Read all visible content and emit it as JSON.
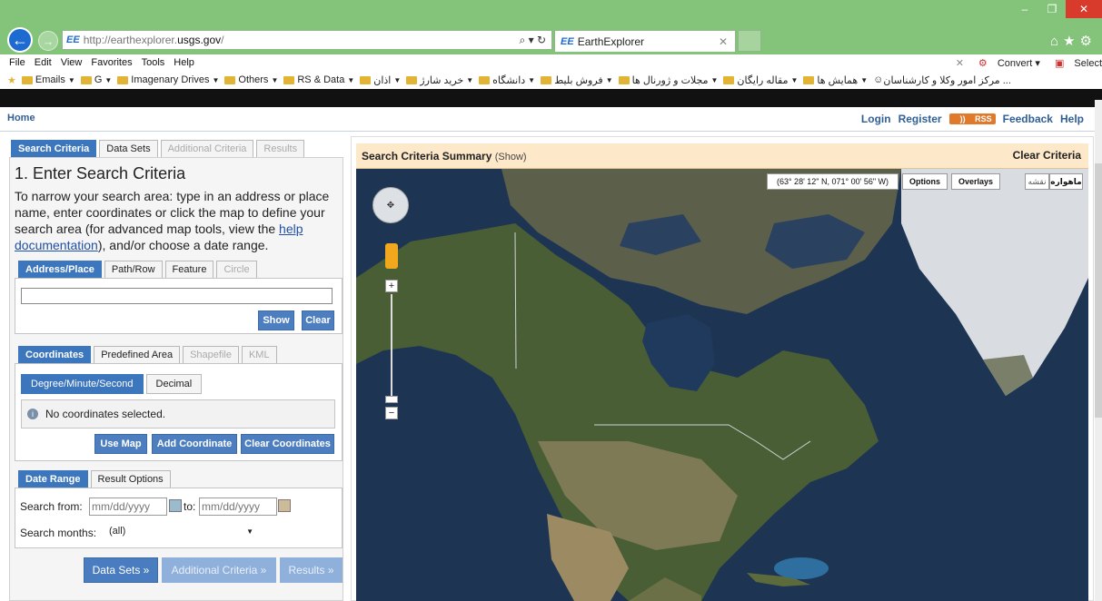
{
  "browser": {
    "url_prefix": "http://earthexplorer.",
    "url_domain": "usgs.gov",
    "url_suffix": "/",
    "favicon_label": "EE",
    "tab_title": "EarthExplorer",
    "menu": [
      "File",
      "Edit",
      "View",
      "Favorites",
      "Tools",
      "Help"
    ],
    "menu_right": {
      "convert": "Convert",
      "select": "Select"
    },
    "favorites": [
      "Emails",
      "G",
      "Imagenary Drives",
      "Others",
      "RS & Data",
      "اذان",
      "خرید شارژ",
      "دانشگاه",
      "فروش بلیط",
      "مجلات و ژورنال ها",
      "مقاله رایگان",
      "همایش ها",
      "مرکز امور وکلا و کارشناسان ..."
    ]
  },
  "site": {
    "home": "Home",
    "links": {
      "login": "Login",
      "register": "Register",
      "rss": "RSS",
      "feedback": "Feedback",
      "help": "Help"
    }
  },
  "left": {
    "main_tabs": [
      "Search Criteria",
      "Data Sets",
      "Additional Criteria",
      "Results"
    ],
    "step_title": "1. Enter Search Criteria",
    "desc_before": "To narrow your search area: type in an address or place name, enter coordinates or click the map to define your search area (for advanced map tools, view the ",
    "desc_link": "help documentation",
    "desc_after": "), and/or choose a date range.",
    "place_tabs": [
      "Address/Place",
      "Path/Row",
      "Feature",
      "Circle"
    ],
    "place_input_value": "",
    "show_label": "Show",
    "clear_label": "Clear",
    "coord_tabs": [
      "Coordinates",
      "Predefined Area",
      "Shapefile",
      "KML"
    ],
    "format_tabs": [
      "Degree/Minute/Second",
      "Decimal"
    ],
    "no_coords": "No coordinates selected.",
    "use_map": "Use Map",
    "add_coord": "Add Coordinate",
    "clear_coords": "Clear Coordinates",
    "date_tabs": [
      "Date Range",
      "Result Options"
    ],
    "search_from_label": "Search from:",
    "date_placeholder": "mm/dd/yyyy",
    "to_label": "to:",
    "search_months_label": "Search months:",
    "months_value": "(all)",
    "nav_buttons": [
      "Data Sets »",
      "Additional Criteria »",
      "Results »"
    ]
  },
  "map": {
    "summary_title": "Search Criteria Summary",
    "summary_show": "(Show)",
    "clear_criteria": "Clear Criteria",
    "coords": "(63° 28' 12\" N, 071° 00' 56\" W)",
    "options": "Options",
    "overlays": "Overlays",
    "type_buttons": [
      "نقشه",
      "ماهواره"
    ]
  },
  "colors": {
    "accent": "#3c76bd",
    "titlebar": "#83c37a",
    "ocean": "#1d3553",
    "land": "#4a5e36"
  }
}
